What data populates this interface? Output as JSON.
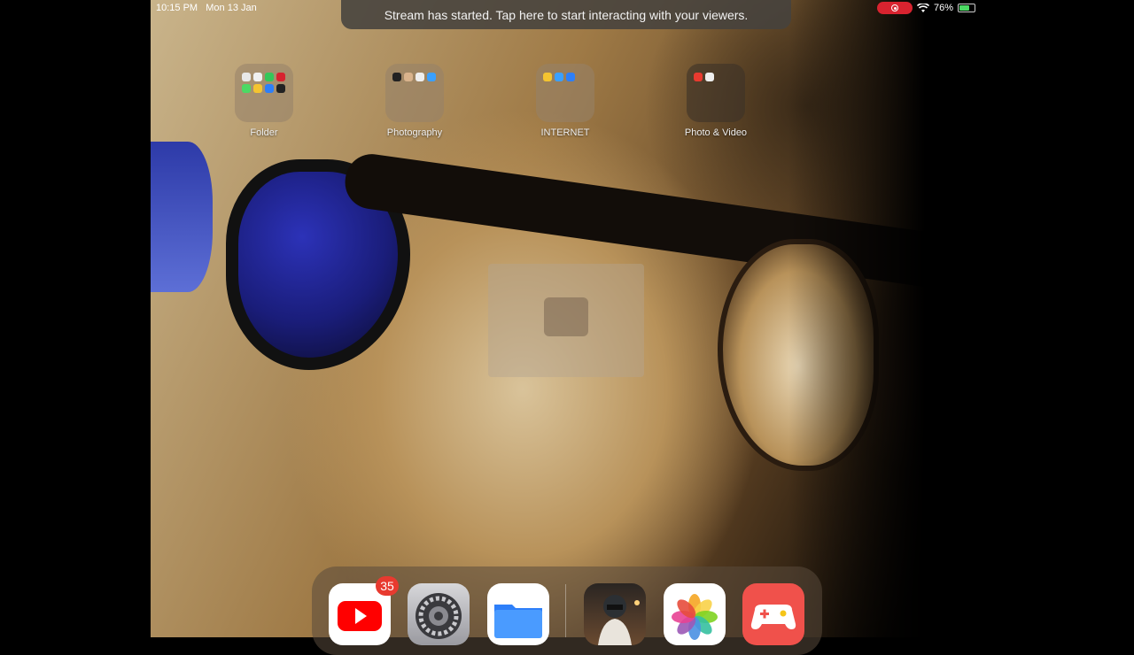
{
  "status_bar": {
    "time": "10:15 PM",
    "date": "Mon 13 Jan",
    "battery": "76%",
    "battery_level": 0.76,
    "icons": [
      "screen-record-icon",
      "wifi-icon",
      "battery-icon"
    ]
  },
  "banner": {
    "text": "Stream has started. Tap here to start interacting with your viewers."
  },
  "folders": [
    {
      "label": "Folder",
      "mini_colors": [
        "#e8e8e8",
        "#f0f0f0",
        "#34c759",
        "#d8232f",
        "#4cd964",
        "#f4c430",
        "#2d7ff9",
        "#222222"
      ]
    },
    {
      "label": "Photography",
      "mini_colors": [
        "#222222",
        "#d9b38c",
        "#eeeeee",
        "#3aa0ff"
      ]
    },
    {
      "label": "INTERNET",
      "mini_colors": [
        "#f4c430",
        "#3aa0ff",
        "#2d7ff9"
      ]
    },
    {
      "label": "Photo & Video",
      "mini_colors": [
        "#e83a2f",
        "#eeeeee"
      ]
    }
  ],
  "dock": {
    "apps": [
      {
        "name": "YouTube",
        "icon": "youtube-icon",
        "badge": "35"
      },
      {
        "name": "Settings",
        "icon": "settings-gear-icon"
      },
      {
        "name": "Files",
        "icon": "files-folder-icon"
      },
      {
        "name": "PUBG Mobile",
        "icon": "pubg-icon"
      },
      {
        "name": "Photos",
        "icon": "photos-icon"
      },
      {
        "name": "Game Center",
        "icon": "gamepad-icon"
      }
    ]
  },
  "colors": {
    "accent_red": "#d8232f",
    "battery_green": "#4cd964",
    "files_blue": "#2d7ff9"
  }
}
